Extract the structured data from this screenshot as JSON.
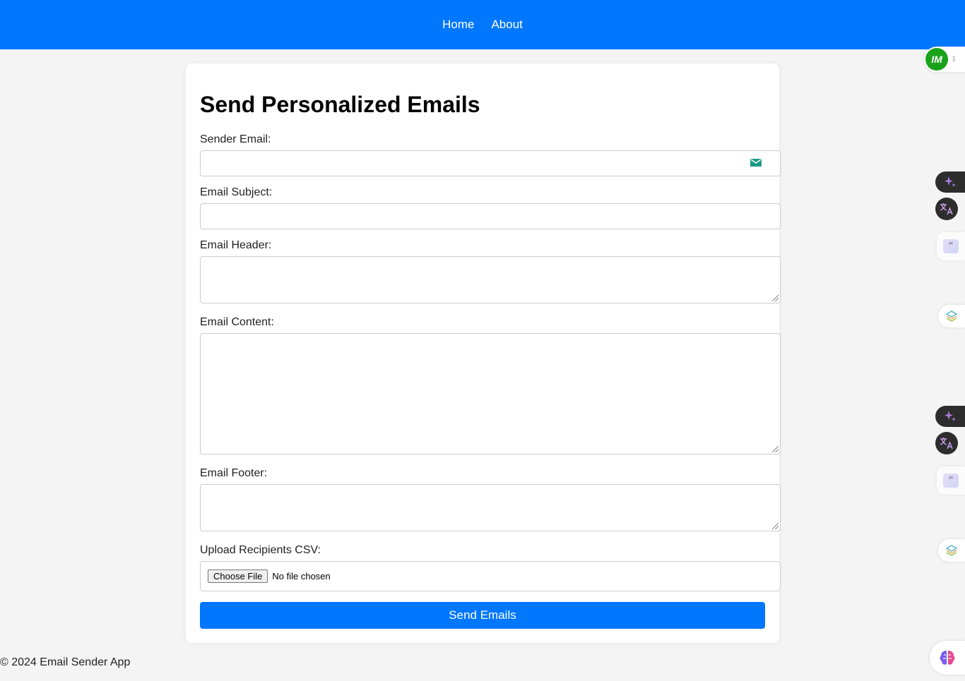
{
  "nav": {
    "home_label": "Home",
    "about_label": "About"
  },
  "form": {
    "title": "Send Personalized Emails",
    "sender_email_label": "Sender Email:",
    "sender_email_value": "",
    "subject_label": "Email Subject:",
    "subject_value": "",
    "header_label": "Email Header:",
    "header_value": "",
    "content_label": "Email Content:",
    "content_value": "",
    "footer_label": "Email Footer:",
    "footer_value": "",
    "csv_label": "Upload Recipients CSV:",
    "choose_file_label": "Choose File",
    "no_file_text": "No file chosen",
    "submit_label": "Send Emails"
  },
  "page_footer": {
    "copyright": "© 2024 Email Sender App"
  },
  "extensions": {
    "im_badge_text": "IM",
    "icons": [
      "im-logo-icon",
      "sparkle-icon",
      "translate-icon",
      "terminal-face-icon",
      "layers-icon",
      "brain-icon"
    ]
  },
  "colors": {
    "primary": "#0077ff",
    "background": "#f4f4f4",
    "card": "#ffffff",
    "im_badge": "#1aa31a"
  }
}
